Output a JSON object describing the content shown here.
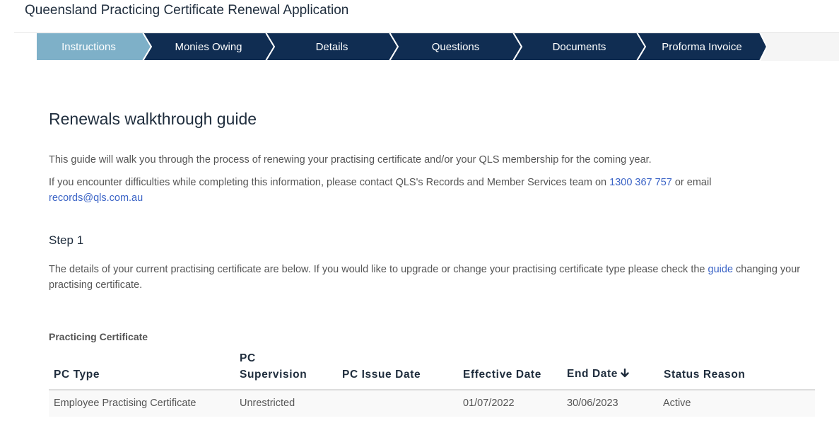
{
  "app": {
    "title": "Queensland Practicing Certificate Renewal Application"
  },
  "steps": [
    {
      "label": "Instructions",
      "active": true
    },
    {
      "label": "Monies Owing",
      "active": false
    },
    {
      "label": "Details",
      "active": false
    },
    {
      "label": "Questions",
      "active": false
    },
    {
      "label": "Documents",
      "active": false
    },
    {
      "label": "Proforma Invoice",
      "active": false
    }
  ],
  "colors": {
    "step_active": "#7eb0c8",
    "step_inactive": "#102d52",
    "link": "#3a63c6",
    "heading": "#1f2d3d"
  },
  "guide": {
    "title": "Renewals walkthrough guide",
    "intro": "This guide will walk you through the process of renewing your practising certificate and/or your QLS membership for the coming year.",
    "contact_before": "If you encounter difficulties while completing this information, please contact QLS's Records and Member Services team on ",
    "phone": "1300 367 757",
    "contact_middle": " or email",
    "email": "records@qls.com.au"
  },
  "step1": {
    "title": "Step 1",
    "text_before": "The details of your current practising certificate are below. If you would like to upgrade or change your practising certificate type please check the ",
    "link": "guide",
    "text_after": " changing your practising certificate."
  },
  "table": {
    "label": "Practicing Certificate",
    "columns": [
      "PC Type",
      "PC Supervision",
      "PC Issue Date",
      "Effective Date",
      "End Date",
      "Status Reason"
    ],
    "sort_icon": "arrow-down-icon",
    "rows": [
      [
        "Employee Practising Certificate",
        "Unrestricted",
        "",
        "01/07/2022",
        "30/06/2023",
        "Active"
      ]
    ]
  }
}
